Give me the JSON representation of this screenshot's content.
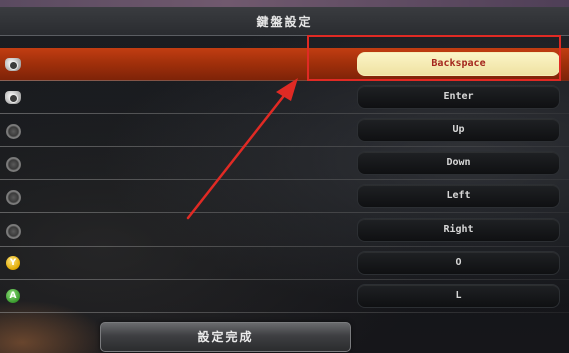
{
  "header": {
    "title": "鍵盤設定"
  },
  "rows": [
    {
      "icon": "camera-icon",
      "key": "Backspace",
      "selected": true
    },
    {
      "icon": "camera-rotate-icon",
      "key": "Enter",
      "selected": false
    },
    {
      "icon": "left-stick-up-icon",
      "key": "Up",
      "selected": false
    },
    {
      "icon": "left-stick-down-icon",
      "key": "Down",
      "selected": false
    },
    {
      "icon": "left-stick-left-icon",
      "key": "Left",
      "selected": false
    },
    {
      "icon": "left-stick-right-icon",
      "key": "Right",
      "selected": false
    },
    {
      "icon": "y-button-icon",
      "icon_letter": "Y",
      "key": "O",
      "selected": false
    },
    {
      "icon": "a-button-icon",
      "icon_letter": "A",
      "key": "L",
      "selected": false
    }
  ],
  "footer": {
    "done_label": "設定完成"
  },
  "colors": {
    "selected_row": "#a1300b",
    "active_key_bg": "#f4eab0",
    "active_key_text": "#a4261d",
    "annotation": "#e02a24"
  }
}
